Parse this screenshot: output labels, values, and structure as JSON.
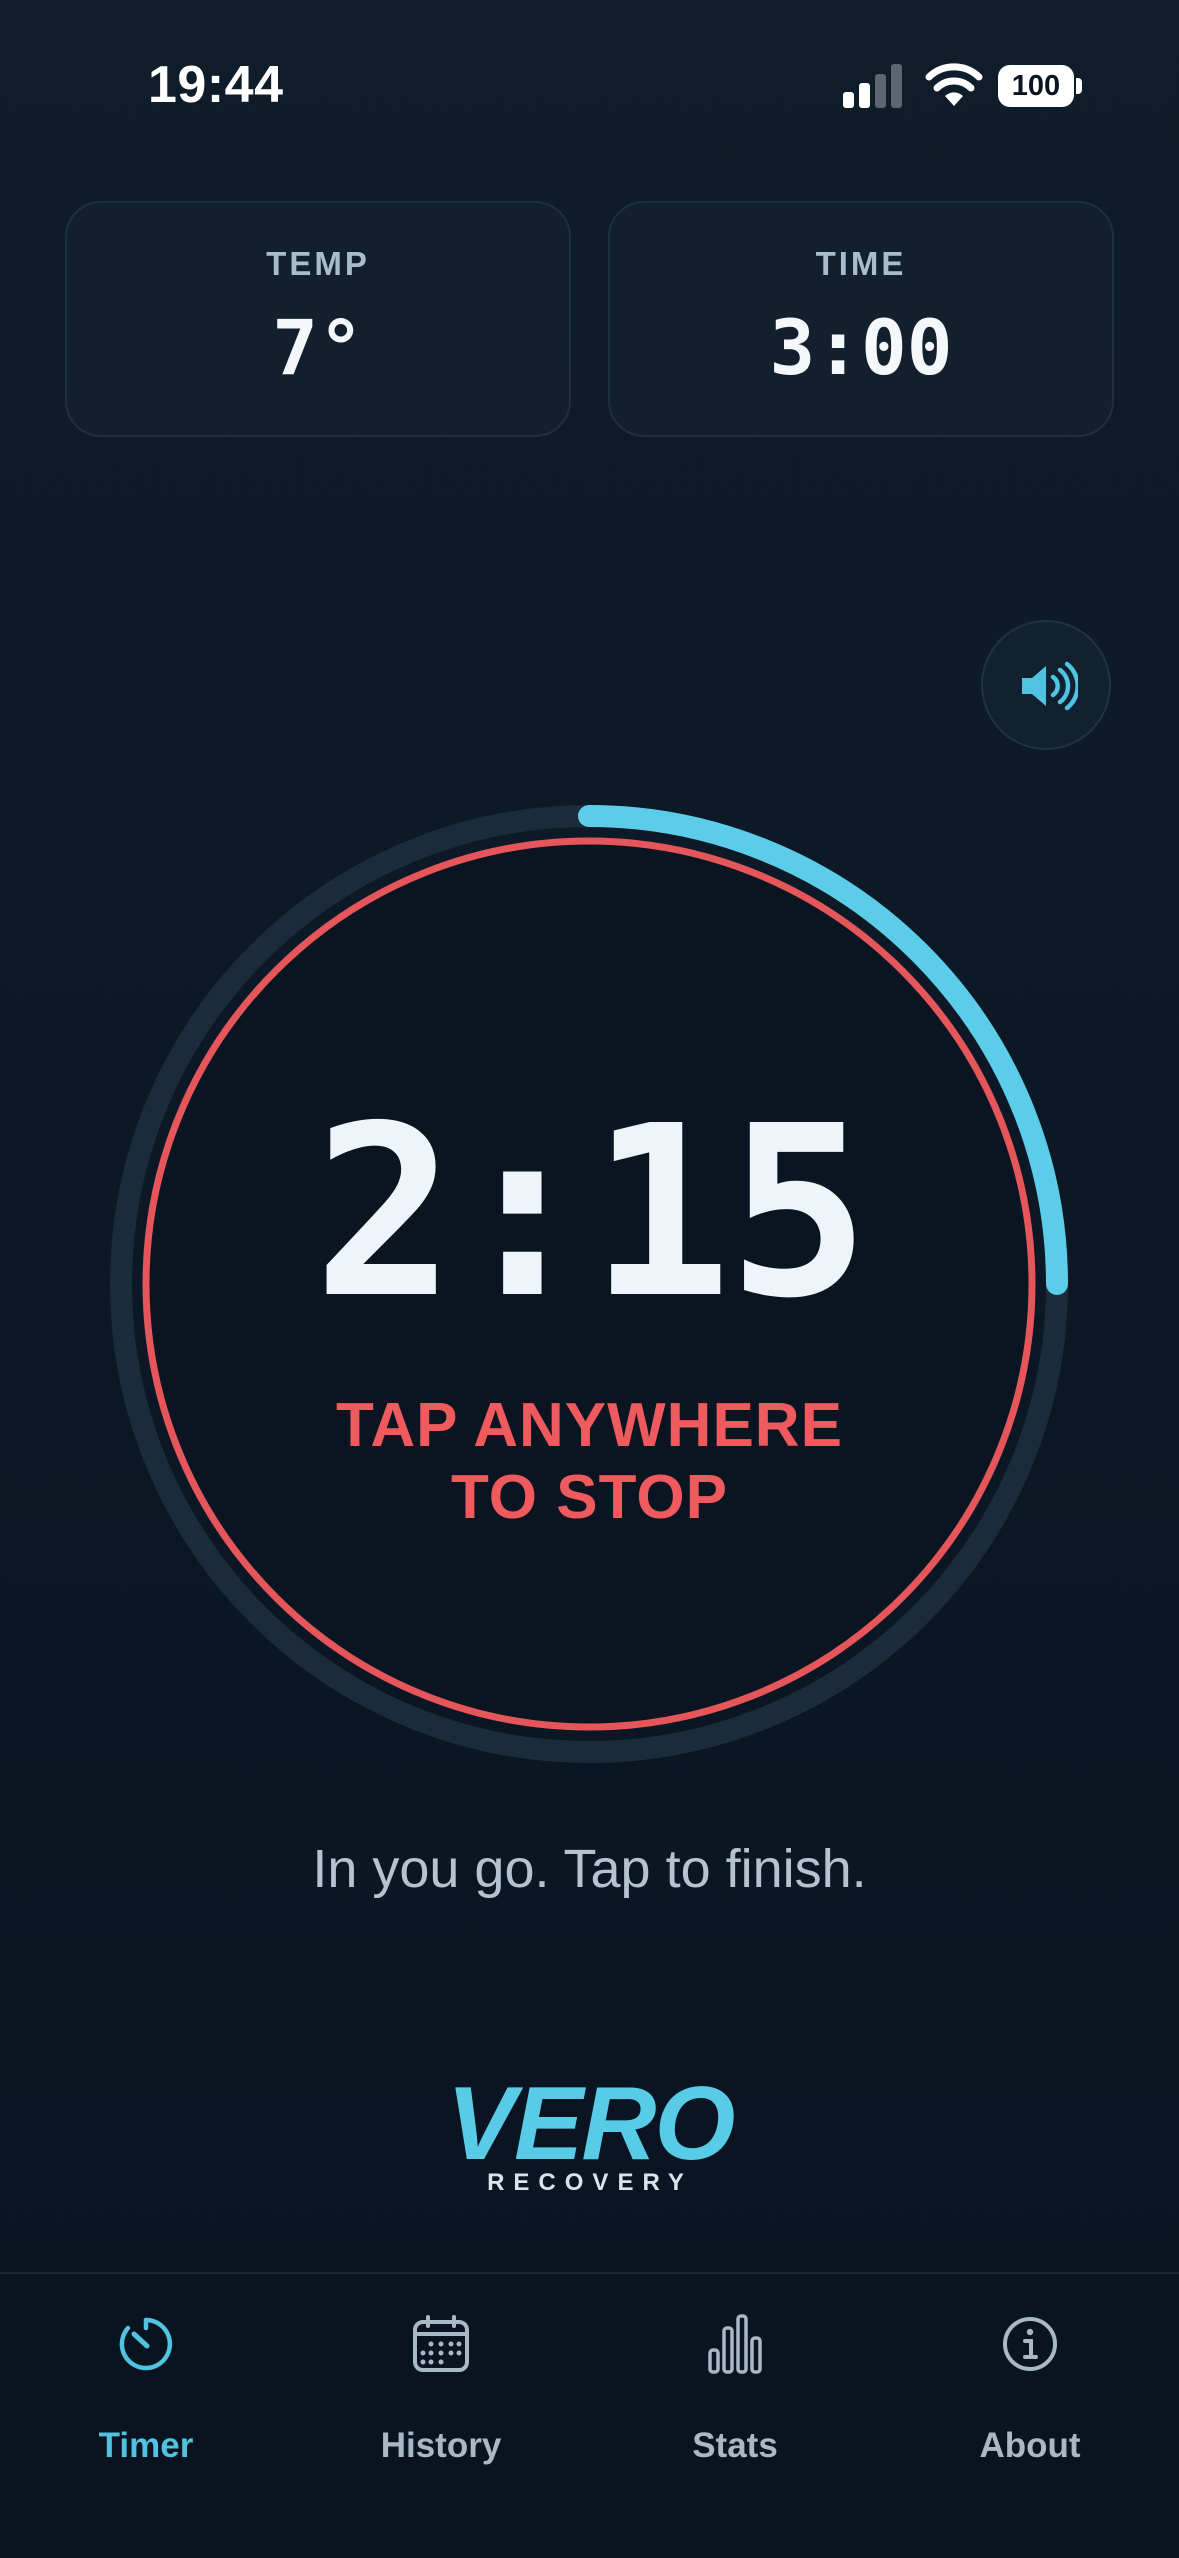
{
  "status_bar": {
    "time": "19:44",
    "battery": "100"
  },
  "cards": {
    "temp": {
      "label": "TEMP",
      "value": "7°"
    },
    "time": {
      "label": "TIME",
      "value": "3:00"
    }
  },
  "timer": {
    "readout": "2:15",
    "hint_line1": "TAP ANYWHERE",
    "hint_line2": "TO STOP",
    "progress_fraction": 0.25
  },
  "prompt": "In you go. Tap to finish.",
  "logo": {
    "word": "VERO",
    "sub": "RECOVERY"
  },
  "tabs": [
    {
      "label": "Timer",
      "icon": "timer-icon",
      "active": true
    },
    {
      "label": "History",
      "icon": "calendar-icon",
      "active": false
    },
    {
      "label": "Stats",
      "icon": "bar-chart-icon",
      "active": false
    },
    {
      "label": "About",
      "icon": "info-icon",
      "active": false
    }
  ],
  "colors": {
    "accent": "#4fc3e0",
    "stop": "#ee5a5e",
    "background": "#0c1826"
  }
}
